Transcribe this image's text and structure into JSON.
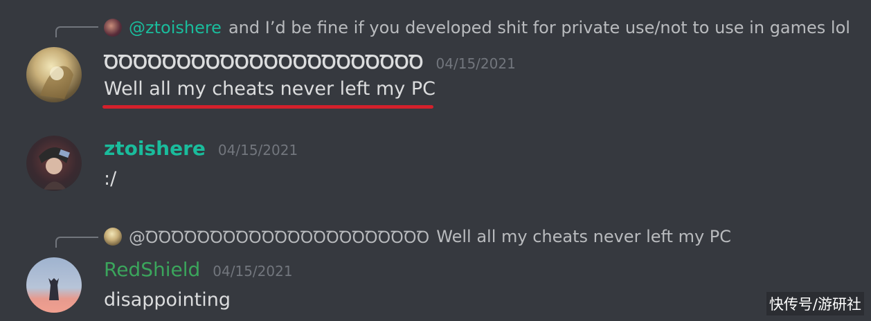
{
  "colors": {
    "background": "#36393f",
    "mention": "#5865f2",
    "green_name": "#3ba55c",
    "teal_name": "#1abc9c",
    "white_name": "#dcddde",
    "underline": "#d4202b"
  },
  "messages": [
    {
      "reply": {
        "mention": "@ztoishere",
        "text": "and I’d be fine if you developed shit for private use/not to use in games lol"
      },
      "username": "ꝹꝹꝹꝹꝹꝹꝹꝹꝹꝹꝹꝹꝹꝹꝹꝹꝹꝹꝹꝹꝹꝹ",
      "timestamp": "04/15/2021",
      "text": "Well all my cheats never left my PC"
    },
    {
      "username": "ztoishere",
      "timestamp": "04/15/2021",
      "text": ":/"
    },
    {
      "reply": {
        "mention": "@ꝹꝹꝹꝹꝹꝹꝹꝹꝹꝹꝹꝹꝹꝹꝹꝹꝹꝹꝹꝹꝹꝹ",
        "text": "Well all my cheats never left my PC"
      },
      "username": "RedShield",
      "timestamp": "04/15/2021",
      "text": "disappointing"
    }
  ],
  "watermark": "快传号/游研社"
}
